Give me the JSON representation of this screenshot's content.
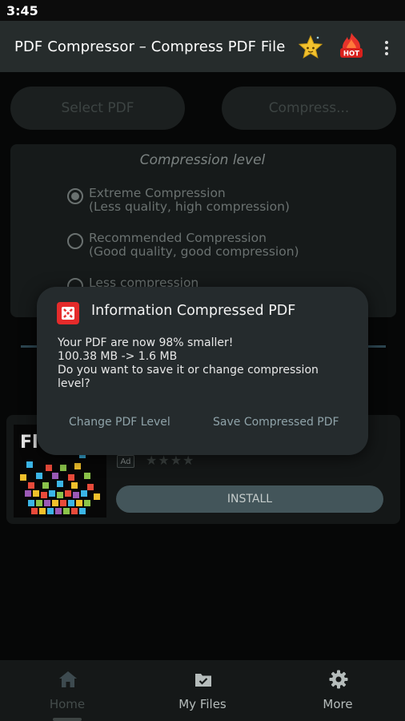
{
  "status_bar": {
    "time": "3:45"
  },
  "app_bar": {
    "title": "PDF Compressor – Compress PDF File",
    "star_icon": "star-icon",
    "hot_icon": "hot-icon",
    "hot_label": "HOT",
    "more_icon": "more-vert-icon"
  },
  "actions": {
    "select_label": "Select PDF",
    "compress_label": "Compress..."
  },
  "compression": {
    "title": "Compression level",
    "options": [
      {
        "line1": "Extreme Compression",
        "line2": "(Less quality, high compression)",
        "selected": true
      },
      {
        "line1": "Recommended Compression",
        "line2": "(Good quality, good compression)",
        "selected": false
      },
      {
        "line1": "Less compression",
        "line2": "",
        "selected": false
      }
    ]
  },
  "ad": {
    "image_text": "Fl",
    "badge": "Ad",
    "stars": "★★★★",
    "install_label": "INSTALL"
  },
  "dialog": {
    "title": "Information Compressed PDF",
    "message": "Your PDF are now 98% smaller!\n100.38 MB -> 1.6 MB\nDo you want to save it or change compression level?",
    "change_label": "Change PDF Level",
    "save_label": "Save Compressed PDF"
  },
  "bottom_nav": [
    {
      "label": "Home",
      "icon": "home-icon",
      "active": true
    },
    {
      "label": "My Files",
      "icon": "folder-check-icon",
      "active": false
    },
    {
      "label": "More",
      "icon": "gear-icon",
      "active": false
    }
  ],
  "colors": {
    "app_bar": "#262c2c",
    "dialog": "#252b2d",
    "accent": "#8fa3a9",
    "install": "#43555a"
  }
}
